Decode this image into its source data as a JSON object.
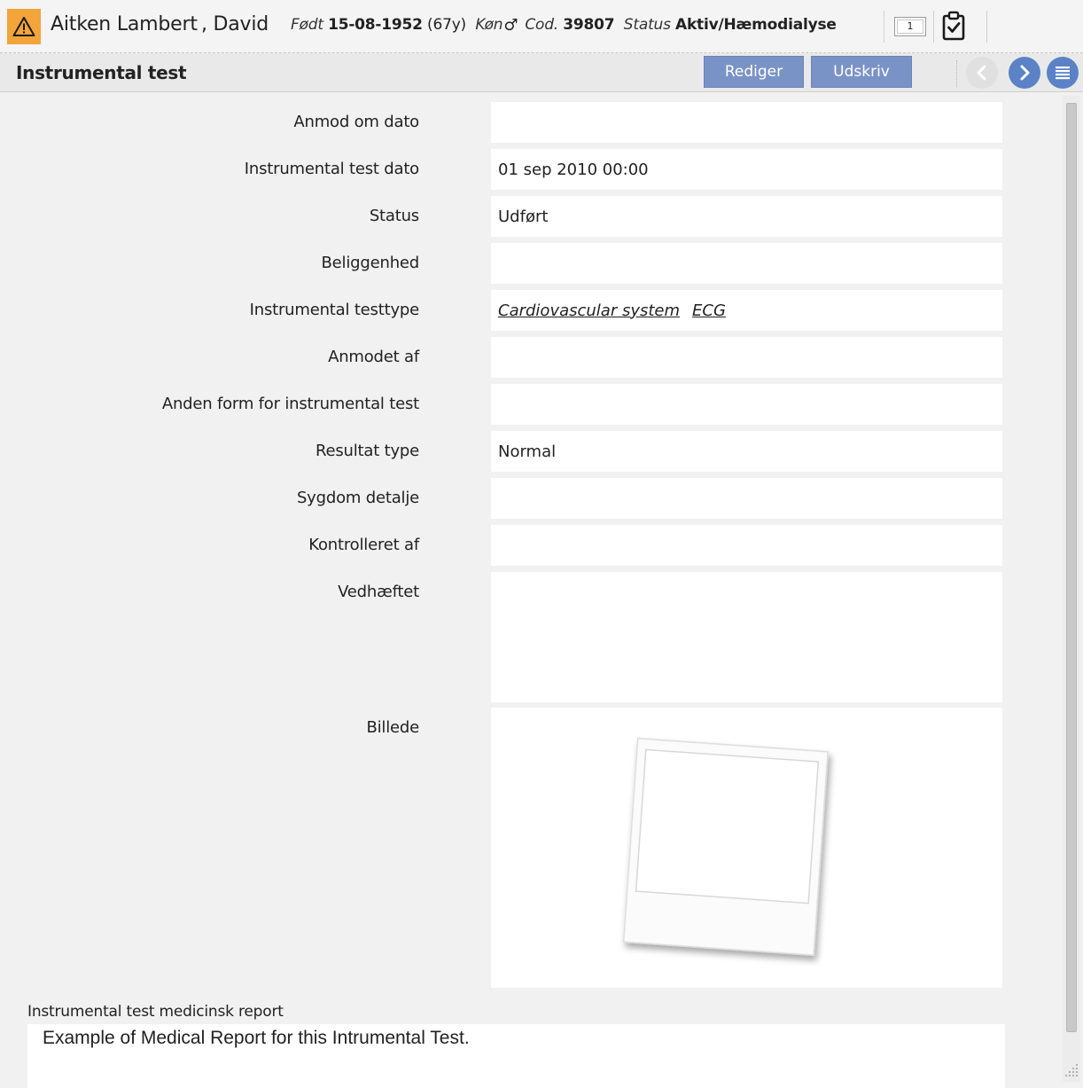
{
  "patient": {
    "name": "Aitken Lambert , David",
    "born_label": "Født",
    "born_value": "15-08-1952",
    "age": "(67y)",
    "gender_label": "Køn",
    "code_label": "Cod.",
    "code_value": "39807",
    "status_label": "Status",
    "status_value": "Aktiv/Hæmodialyse",
    "badge_count": "1",
    "accent_color": "#f3a43a"
  },
  "toolbar": {
    "title": "Instrumental test",
    "edit_label": "Rediger",
    "print_label": "Udskriv",
    "button_color": "#7a93c6",
    "nav_color": "#5b82c6"
  },
  "fields": [
    {
      "label": "Anmod om dato",
      "value": ""
    },
    {
      "label": "Instrumental test dato",
      "value": "01 sep 2010 00:00"
    },
    {
      "label": "Status",
      "value": "Udført"
    },
    {
      "label": "Beliggenhed",
      "value": ""
    },
    {
      "label": "Instrumental testtype",
      "links": [
        "Cardiovascular system",
        "ECG"
      ]
    },
    {
      "label": "Anmodet af",
      "value": ""
    },
    {
      "label": "Anden form for instrumental test",
      "value": ""
    },
    {
      "label": "Resultat type",
      "value": "Normal"
    },
    {
      "label": "Sygdom detalje",
      "value": ""
    },
    {
      "label": "Kontrolleret af",
      "value": ""
    },
    {
      "label": "Vedhæftet",
      "value": ""
    },
    {
      "label": "Billede"
    }
  ],
  "report": {
    "label": "Instrumental test medicinsk report",
    "text": "Example of Medical Report for this Intrumental Test."
  }
}
